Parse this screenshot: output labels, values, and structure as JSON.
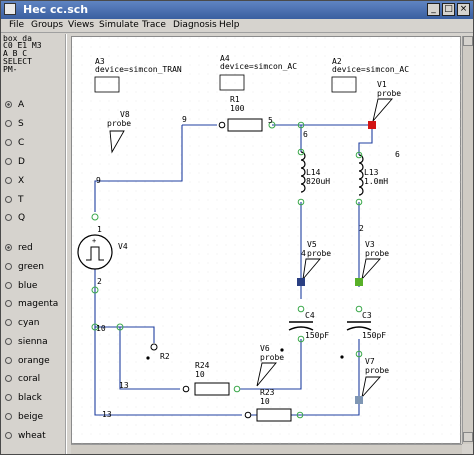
{
  "window": {
    "title": "Hec cc.sch",
    "buttons": [
      "_",
      "□",
      "×"
    ]
  },
  "menu": {
    "items": [
      "File",
      "Groups",
      "Views",
      "Simulate",
      "Trace",
      "Diagnosis",
      "Help"
    ]
  },
  "sidebar": {
    "header_lines": [
      "box_da",
      "C0 E1 M3",
      "A B C",
      "SELECT",
      "PM-"
    ],
    "modes": [
      "A",
      "S",
      "C",
      "D",
      "X",
      "T",
      "Q"
    ],
    "selected_mode": "A",
    "colors": [
      "red",
      "green",
      "blue",
      "magenta",
      "cyan",
      "sienna",
      "orange",
      "coral",
      "black",
      "beige",
      "wheat"
    ],
    "selected_color": "red"
  },
  "schematic": {
    "analyses": [
      {
        "name": "A3",
        "device": "device=simcon_TRAN"
      },
      {
        "name": "A4",
        "device": "device=simcon_AC"
      },
      {
        "name": "A2",
        "device": "device=simcon_AC"
      }
    ],
    "components": {
      "R1": {
        "name": "R1",
        "value": "100"
      },
      "L14": {
        "name": "L14",
        "value": "820uH"
      },
      "L13": {
        "name": "L13",
        "value": "1.0mH"
      },
      "V4": {
        "name": "V4"
      },
      "R2": {
        "name": "R2"
      },
      "C4": {
        "name": "C4",
        "value": "150pF"
      },
      "C3": {
        "name": "C3",
        "value": "150pF"
      },
      "R24": {
        "name": "R24",
        "value": "10"
      },
      "R23": {
        "name": "R23",
        "value": "10"
      }
    },
    "probes": [
      {
        "name": "V8",
        "label": "probe"
      },
      {
        "name": "V1",
        "label": "probe"
      },
      {
        "name": "V5",
        "label": "probe"
      },
      {
        "name": "V3",
        "label": "probe"
      },
      {
        "name": "V6",
        "label": "probe"
      },
      {
        "name": "V7",
        "label": "probe"
      }
    ],
    "nodes": [
      "9",
      "5",
      "6",
      "6",
      "9",
      "1",
      "2",
      "4",
      "2",
      "10",
      "13",
      "13"
    ],
    "colors": {
      "wire": "#1f3fa0",
      "probe_red": "#d21414",
      "probe_navy": "#2a3f82",
      "probe_green": "#58b028",
      "probe_slate": "#7f96b4",
      "pin": "#3aa84a"
    }
  }
}
